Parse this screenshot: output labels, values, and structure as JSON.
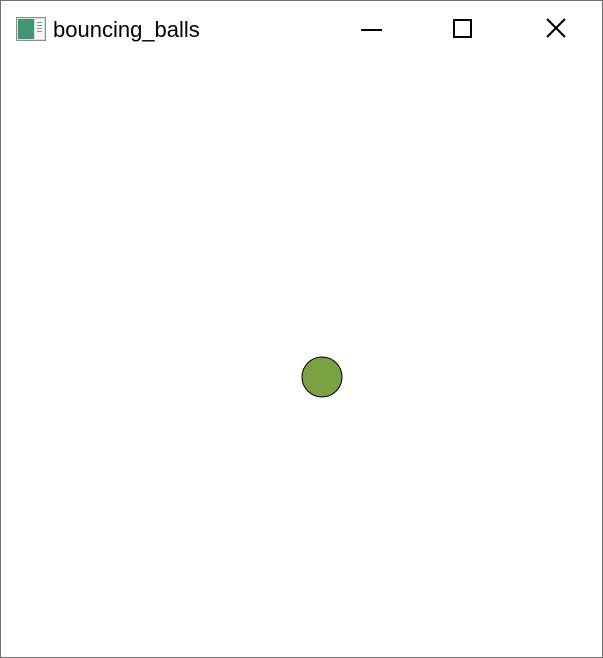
{
  "window": {
    "title": "bouncing_balls",
    "controls": [
      "minimize",
      "maximize",
      "close"
    ]
  },
  "scene": {
    "ball": {
      "fill": "#7aa142",
      "stroke": "#000000"
    }
  },
  "icons": {
    "app": "bouncing-balls-app-icon",
    "minimize": "minimize-icon",
    "maximize": "maximize-icon",
    "close": "close-icon"
  }
}
